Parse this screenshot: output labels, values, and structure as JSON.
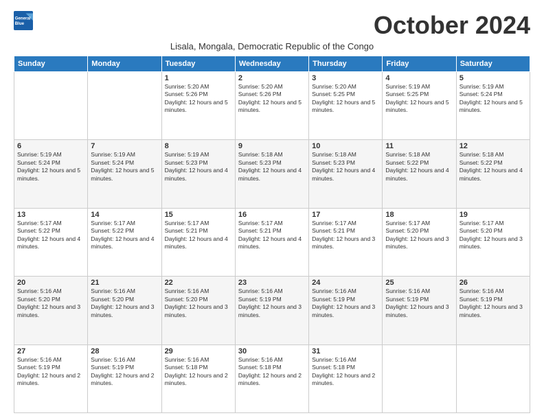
{
  "logo": {
    "general": "General",
    "blue": "Blue"
  },
  "title": "October 2024",
  "subtitle": "Lisala, Mongala, Democratic Republic of the Congo",
  "days_of_week": [
    "Sunday",
    "Monday",
    "Tuesday",
    "Wednesday",
    "Thursday",
    "Friday",
    "Saturday"
  ],
  "weeks": [
    [
      {
        "day": "",
        "text": ""
      },
      {
        "day": "",
        "text": ""
      },
      {
        "day": "1",
        "text": "Sunrise: 5:20 AM\nSunset: 5:26 PM\nDaylight: 12 hours and 5 minutes."
      },
      {
        "day": "2",
        "text": "Sunrise: 5:20 AM\nSunset: 5:26 PM\nDaylight: 12 hours and 5 minutes."
      },
      {
        "day": "3",
        "text": "Sunrise: 5:20 AM\nSunset: 5:25 PM\nDaylight: 12 hours and 5 minutes."
      },
      {
        "day": "4",
        "text": "Sunrise: 5:19 AM\nSunset: 5:25 PM\nDaylight: 12 hours and 5 minutes."
      },
      {
        "day": "5",
        "text": "Sunrise: 5:19 AM\nSunset: 5:24 PM\nDaylight: 12 hours and 5 minutes."
      }
    ],
    [
      {
        "day": "6",
        "text": "Sunrise: 5:19 AM\nSunset: 5:24 PM\nDaylight: 12 hours and 5 minutes."
      },
      {
        "day": "7",
        "text": "Sunrise: 5:19 AM\nSunset: 5:24 PM\nDaylight: 12 hours and 5 minutes."
      },
      {
        "day": "8",
        "text": "Sunrise: 5:19 AM\nSunset: 5:23 PM\nDaylight: 12 hours and 4 minutes."
      },
      {
        "day": "9",
        "text": "Sunrise: 5:18 AM\nSunset: 5:23 PM\nDaylight: 12 hours and 4 minutes."
      },
      {
        "day": "10",
        "text": "Sunrise: 5:18 AM\nSunset: 5:23 PM\nDaylight: 12 hours and 4 minutes."
      },
      {
        "day": "11",
        "text": "Sunrise: 5:18 AM\nSunset: 5:22 PM\nDaylight: 12 hours and 4 minutes."
      },
      {
        "day": "12",
        "text": "Sunrise: 5:18 AM\nSunset: 5:22 PM\nDaylight: 12 hours and 4 minutes."
      }
    ],
    [
      {
        "day": "13",
        "text": "Sunrise: 5:17 AM\nSunset: 5:22 PM\nDaylight: 12 hours and 4 minutes."
      },
      {
        "day": "14",
        "text": "Sunrise: 5:17 AM\nSunset: 5:22 PM\nDaylight: 12 hours and 4 minutes."
      },
      {
        "day": "15",
        "text": "Sunrise: 5:17 AM\nSunset: 5:21 PM\nDaylight: 12 hours and 4 minutes."
      },
      {
        "day": "16",
        "text": "Sunrise: 5:17 AM\nSunset: 5:21 PM\nDaylight: 12 hours and 4 minutes."
      },
      {
        "day": "17",
        "text": "Sunrise: 5:17 AM\nSunset: 5:21 PM\nDaylight: 12 hours and 3 minutes."
      },
      {
        "day": "18",
        "text": "Sunrise: 5:17 AM\nSunset: 5:20 PM\nDaylight: 12 hours and 3 minutes."
      },
      {
        "day": "19",
        "text": "Sunrise: 5:17 AM\nSunset: 5:20 PM\nDaylight: 12 hours and 3 minutes."
      }
    ],
    [
      {
        "day": "20",
        "text": "Sunrise: 5:16 AM\nSunset: 5:20 PM\nDaylight: 12 hours and 3 minutes."
      },
      {
        "day": "21",
        "text": "Sunrise: 5:16 AM\nSunset: 5:20 PM\nDaylight: 12 hours and 3 minutes."
      },
      {
        "day": "22",
        "text": "Sunrise: 5:16 AM\nSunset: 5:20 PM\nDaylight: 12 hours and 3 minutes."
      },
      {
        "day": "23",
        "text": "Sunrise: 5:16 AM\nSunset: 5:19 PM\nDaylight: 12 hours and 3 minutes."
      },
      {
        "day": "24",
        "text": "Sunrise: 5:16 AM\nSunset: 5:19 PM\nDaylight: 12 hours and 3 minutes."
      },
      {
        "day": "25",
        "text": "Sunrise: 5:16 AM\nSunset: 5:19 PM\nDaylight: 12 hours and 3 minutes."
      },
      {
        "day": "26",
        "text": "Sunrise: 5:16 AM\nSunset: 5:19 PM\nDaylight: 12 hours and 3 minutes."
      }
    ],
    [
      {
        "day": "27",
        "text": "Sunrise: 5:16 AM\nSunset: 5:19 PM\nDaylight: 12 hours and 2 minutes."
      },
      {
        "day": "28",
        "text": "Sunrise: 5:16 AM\nSunset: 5:19 PM\nDaylight: 12 hours and 2 minutes."
      },
      {
        "day": "29",
        "text": "Sunrise: 5:16 AM\nSunset: 5:18 PM\nDaylight: 12 hours and 2 minutes."
      },
      {
        "day": "30",
        "text": "Sunrise: 5:16 AM\nSunset: 5:18 PM\nDaylight: 12 hours and 2 minutes."
      },
      {
        "day": "31",
        "text": "Sunrise: 5:16 AM\nSunset: 5:18 PM\nDaylight: 12 hours and 2 minutes."
      },
      {
        "day": "",
        "text": ""
      },
      {
        "day": "",
        "text": ""
      }
    ]
  ]
}
